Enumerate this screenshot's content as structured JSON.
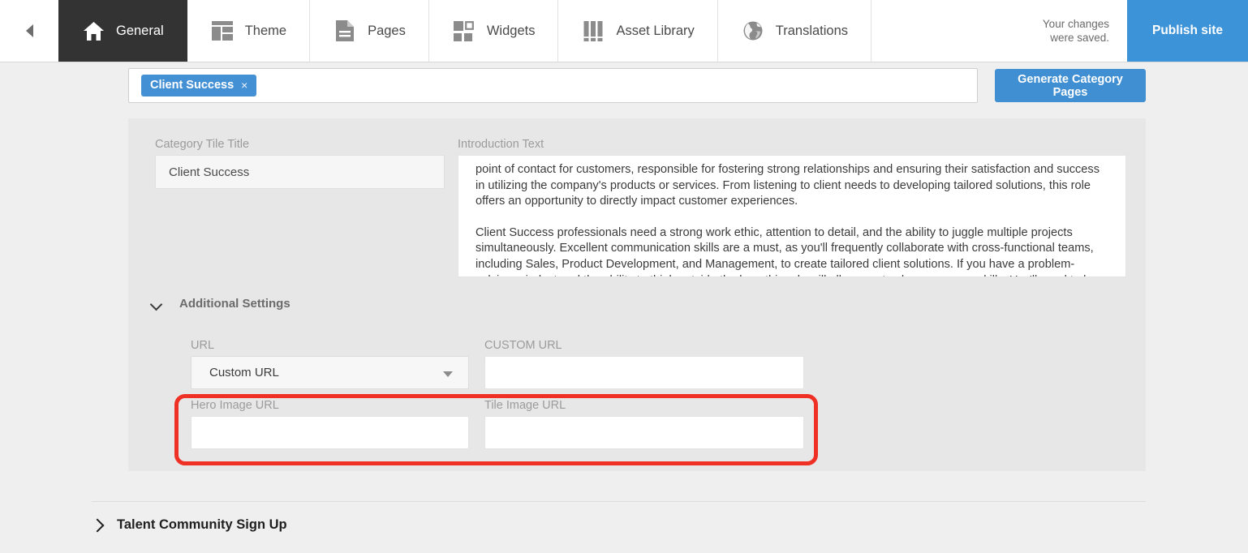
{
  "topnav": {
    "back_icon": "chevron-left-icon",
    "tabs": [
      {
        "id": "general",
        "label": "General",
        "icon": "home-icon",
        "active": true
      },
      {
        "id": "theme",
        "label": "Theme",
        "icon": "layout-icon",
        "active": false
      },
      {
        "id": "pages",
        "label": "Pages",
        "icon": "document-icon",
        "active": false
      },
      {
        "id": "widgets",
        "label": "Widgets",
        "icon": "grid-squares-icon",
        "active": false
      },
      {
        "id": "asset-library",
        "label": "Asset Library",
        "icon": "books-icon",
        "active": false
      },
      {
        "id": "translations",
        "label": "Translations",
        "icon": "globe-icon",
        "active": false
      }
    ],
    "saved_message": "Your changes\nwere saved.",
    "publish_label": "Publish site"
  },
  "category_bar": {
    "token_label": "Client Success",
    "token_remove_icon": "×",
    "generate_label": "Generate Category Pages"
  },
  "form": {
    "category_tile_title": {
      "label": "Category Tile Title",
      "value": "Client Success",
      "placeholder": ""
    },
    "introduction_text": {
      "label": "Introduction Text",
      "paragraphs": [
        "point of contact for customers, responsible for fostering strong relationships and ensuring their satisfaction and success in utilizing the company's products or services. From listening to client needs to developing tailored solutions, this role offers an opportunity to directly impact customer experiences.",
        "Client Success professionals need a strong work ethic, attention to detail, and the ability to juggle multiple projects simultaneously. Excellent communication skills are a must, as you'll frequently collaborate with cross-functional teams, including Sales, Product Development, and Management, to create tailored client solutions. If you have a problem-solving mindset and the ability to think outside the box, this role will allow you to showcase your skills. You'll need to be"
      ]
    },
    "additional_settings": {
      "label": "Additional Settings",
      "expanded": true,
      "chevron_icon": "chevron-down-icon"
    },
    "url": {
      "label": "URL",
      "selected": "Custom URL",
      "options": [
        "Custom URL"
      ],
      "caret_icon": "chevron-down-icon"
    },
    "custom_url": {
      "label": "CUSTOM URL",
      "value": "",
      "placeholder": ""
    },
    "hero_image_url": {
      "label": "Hero Image URL",
      "value": "",
      "placeholder": ""
    },
    "tile_image_url": {
      "label": "Tile Image URL",
      "value": "",
      "placeholder": ""
    }
  },
  "annotation": {
    "highlight_color": "#ee3124"
  },
  "collapsed_section": {
    "label": "Talent Community Sign Up",
    "chevron_icon": "chevron-right-icon",
    "expanded": false
  },
  "colors": {
    "accent_blue": "#3d93d8",
    "token_blue": "#4490d4",
    "active_tab_bg": "#333333",
    "panel_bg": "#e7e7e7",
    "page_bg": "#efefef"
  }
}
